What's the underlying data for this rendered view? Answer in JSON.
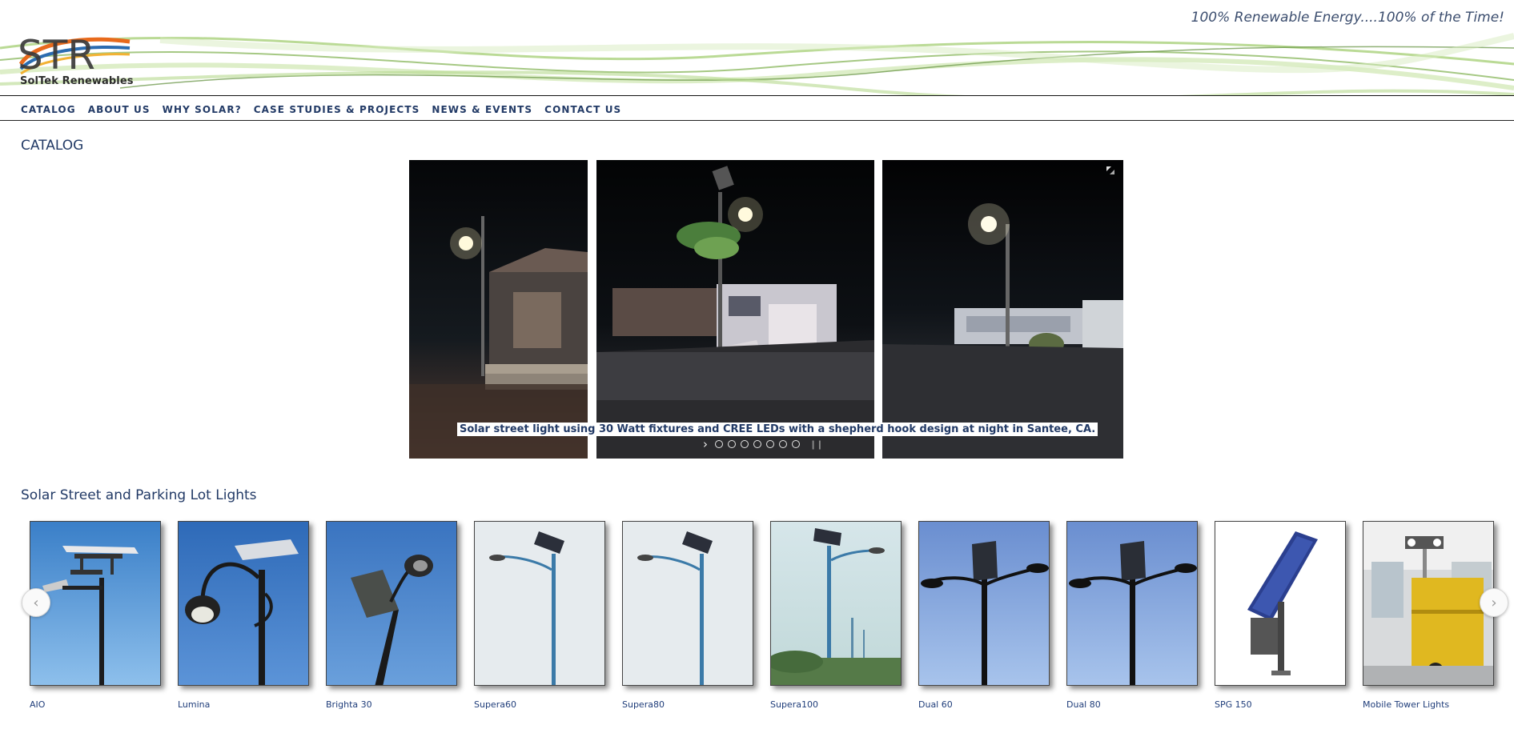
{
  "header": {
    "tagline": "100% Renewable Energy....100% of the Time!",
    "logo_letters": "STR",
    "logo_company": "SolTek Renewables"
  },
  "nav": {
    "items": [
      "CATALOG",
      "ABOUT US",
      "WHY SOLAR?",
      "CASE STUDIES & PROJECTS",
      "NEWS & EVENTS",
      "CONTACT US"
    ]
  },
  "catalog": {
    "title": "CATALOG",
    "slideshow": {
      "caption": "Solar street light using 30 Watt fixtures and CREE LEDs with a shepherd hook design at night in Santee, CA.",
      "next_icon": "chevron-right-icon",
      "pause_icon": "pause-icon",
      "expand_icon": "expand-icon",
      "dot_count": 7
    }
  },
  "products": {
    "title": "Solar Street and Parking Lot Lights",
    "prev_icon": "chevron-left-icon",
    "next_icon": "chevron-right-icon",
    "items": [
      {
        "label": "AIO"
      },
      {
        "label": "Lumina"
      },
      {
        "label": "Brighta 30"
      },
      {
        "label": "Supera60"
      },
      {
        "label": "Supera80"
      },
      {
        "label": "Supera100"
      },
      {
        "label": "Dual 60"
      },
      {
        "label": "Dual 80"
      },
      {
        "label": "SPG 150"
      },
      {
        "label": "Mobile Tower Lights"
      }
    ]
  },
  "colors": {
    "nav_text": "#223a66",
    "link": "#1f3d7a",
    "logo_blue": "#2b6cb0",
    "logo_orange": "#e86a1c",
    "swoosh_green": "#8fbf5a"
  }
}
